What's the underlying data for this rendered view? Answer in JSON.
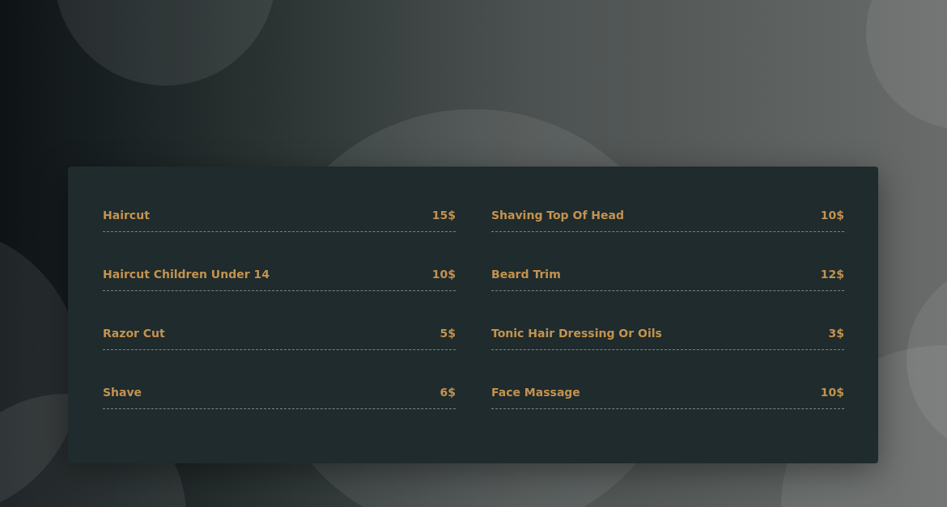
{
  "price_list": {
    "columns": [
      {
        "items": [
          {
            "name": "Haircut",
            "price": "15$"
          },
          {
            "name": "Haircut Children Under 14",
            "price": "10$"
          },
          {
            "name": "Razor Cut",
            "price": "5$"
          },
          {
            "name": "Shave",
            "price": "6$"
          }
        ]
      },
      {
        "items": [
          {
            "name": "Shaving Top Of Head",
            "price": "10$"
          },
          {
            "name": "Beard Trim",
            "price": "12$"
          },
          {
            "name": "Tonic Hair Dressing Or Oils",
            "price": "3$"
          },
          {
            "name": "Face Massage",
            "price": "10$"
          }
        ]
      }
    ]
  }
}
